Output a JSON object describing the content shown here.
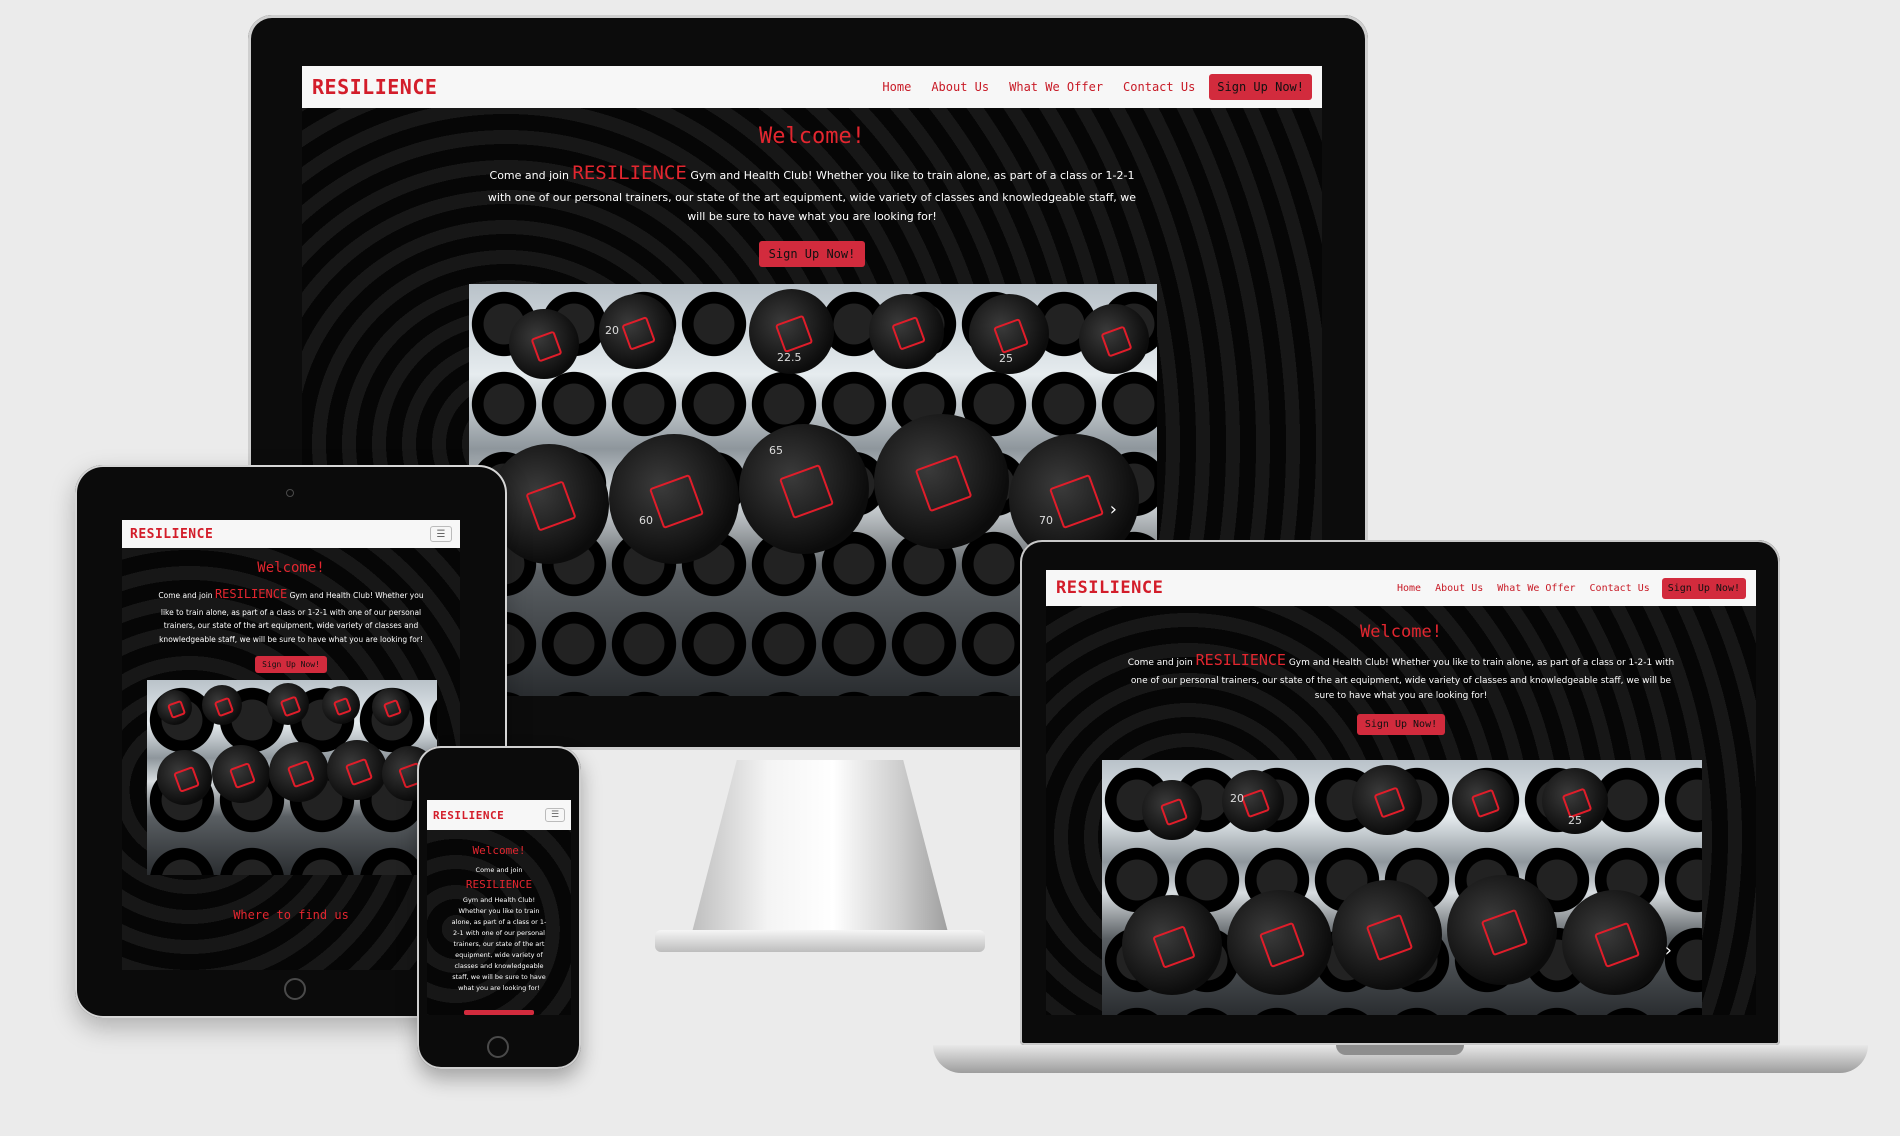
{
  "brand": "RESILIENCE",
  "nav": {
    "links": [
      "Home",
      "About Us",
      "What We Offer",
      "Contact Us"
    ],
    "cta": "Sign Up Now!"
  },
  "hero": {
    "welcome": "Welcome!",
    "intro_before": "Come and join",
    "intro_brand": "RESILIENCE",
    "intro_after": "Gym and Health Club! Whether you like to train alone, as part of a class or 1-2-1 with one of our personal trainers, our state of the art equipment, wide variety of classes and knowledgeable staff, we will be sure to have what you are looking for!",
    "cta": "Sign Up Now!"
  },
  "sections": {
    "find_us": "Where to find us"
  },
  "carousel": {
    "weights": [
      "20",
      "22.5",
      "25",
      "65",
      "60",
      "70",
      "20",
      "25"
    ]
  },
  "colors": {
    "accent": "#d31d2a",
    "button": "#d22b3d",
    "navbar": "#f7f7f7"
  }
}
